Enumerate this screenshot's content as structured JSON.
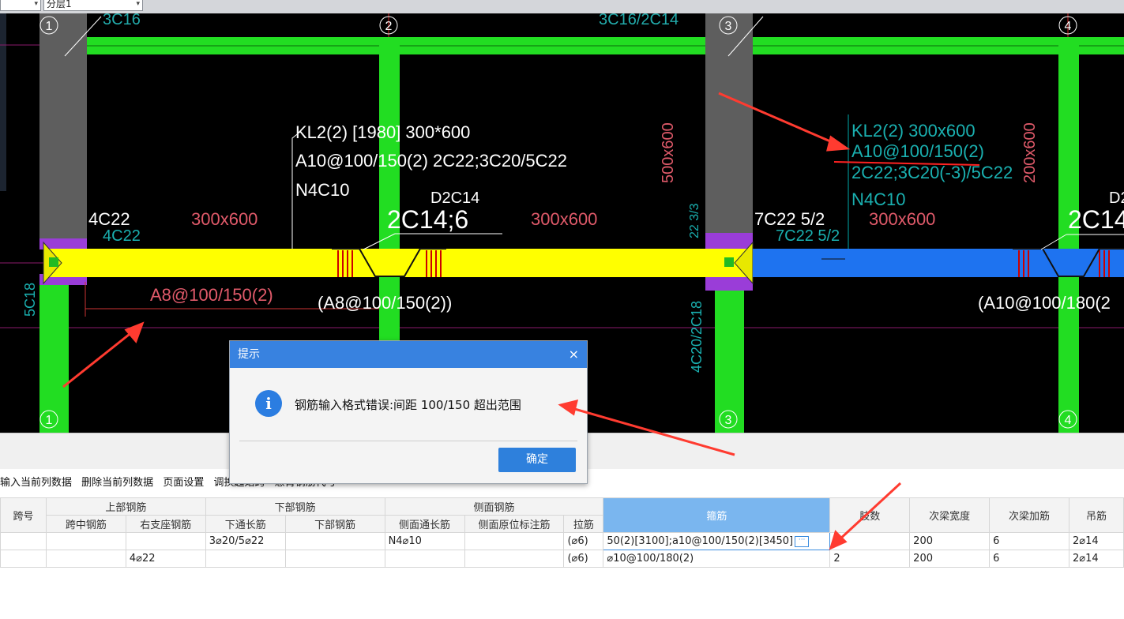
{
  "topbar": {
    "combo1_value": "",
    "combo2_value": "分层1",
    "arrow": "▾"
  },
  "cad": {
    "axis_labels": [
      "1",
      "2",
      "3",
      "4"
    ],
    "column_sizes": [
      "500x600",
      "200x600"
    ],
    "span_sizes": [
      "300x600",
      "300x600",
      "300x600"
    ],
    "beam_callout_1": [
      "KL2(2) [1980] 300*600",
      "A10@100/150(2) 2C22;3C20/5C22",
      "N4C10"
    ],
    "beam_callout_2": [
      "KL2(2) 300x600",
      "A10@100/150(2)",
      "2C22;3C20(-3)/5C22",
      "N4C10"
    ],
    "support_left": "4C22",
    "support_left_dim": "4C22",
    "support_mid": "7C22 5/2",
    "support_mid_dim": "7C22 5/2",
    "hanger_1": "D2C14",
    "hanger_1b": "2C14;6",
    "hanger_2": "D2",
    "hanger_2b": "2C14",
    "stirrup_left": "A8@100/150(2)",
    "stirrup_1": "(A8@100/150(2))",
    "stirrup_2": "(A10@100/180(2",
    "col_top_labels": [
      "3C16",
      "3C16/2C14"
    ],
    "vertical_labels": [
      "5C18",
      "4C20/2C18",
      "22 3/3"
    ],
    "left_mark": "3C1"
  },
  "toolbar": {
    "items": [
      "输入当前列数据",
      "删除当前列数据",
      "页面设置",
      "调换起始跨",
      "悬臂钢筋代号"
    ]
  },
  "table": {
    "group_headers": [
      "跨号",
      "上部钢筋",
      "下部钢筋",
      "侧面钢筋",
      "箍筋",
      "肢数",
      "次梁宽度",
      "次梁加筋",
      "吊筋"
    ],
    "sub_headers": [
      "跨中钢筋",
      "右支座钢筋",
      "下通长筋",
      "下部钢筋",
      "侧面通长筋",
      "侧面原位标注筋",
      "拉筋"
    ],
    "rows": [
      [
        "",
        "",
        "",
        "3⌀20/5⌀22",
        "",
        "N4⌀10",
        "",
        "(⌀6)",
        "50(2)[3100];a10@100/150(2)[3450]",
        "2",
        "200",
        "6",
        "2⌀14"
      ],
      [
        "",
        "",
        "4⌀22",
        "",
        "",
        "",
        "",
        "(⌀6)",
        "⌀10@100/180(2)",
        "2",
        "200",
        "6",
        "2⌀14"
      ]
    ]
  },
  "dialog": {
    "title": "提示",
    "close": "×",
    "icon": "i",
    "message": "钢筋输入格式错误:间距 100/150 超出范围",
    "ok_label": "确定"
  },
  "colors": {
    "cad_background": "#000000",
    "beam_yellow": "#ffff00",
    "beam_blue": "#1e73f0",
    "column_green": "#22dd22",
    "dialog_title": "#3882e0",
    "annotation_red": "#ff3b30",
    "selected_header": "#7ab6ef"
  }
}
